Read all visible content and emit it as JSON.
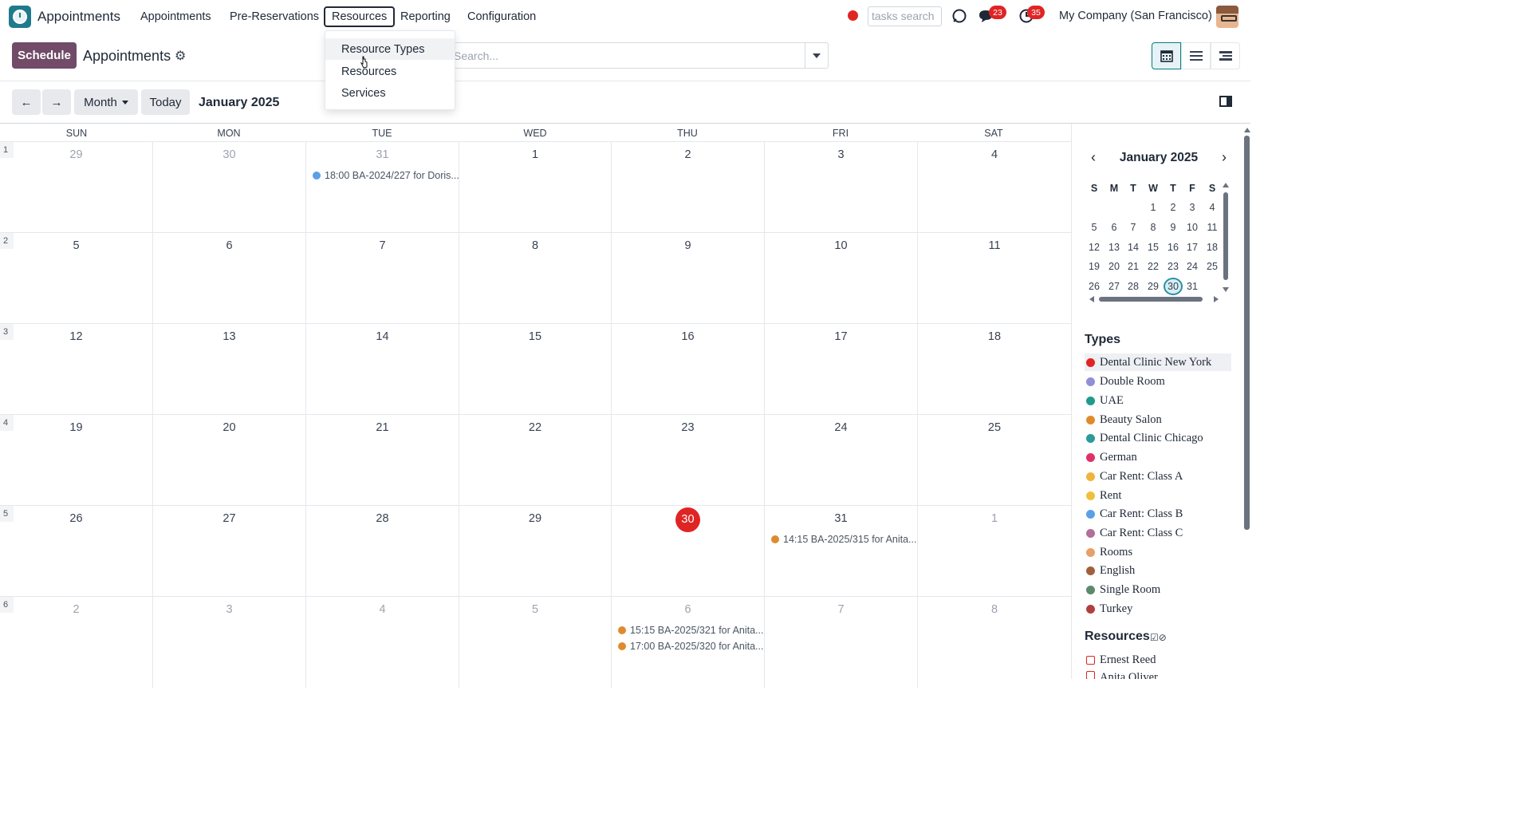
{
  "navbar": {
    "app_name": "Appointments",
    "menus": [
      "Appointments",
      "Pre-Reservations",
      "Resources",
      "Reporting",
      "Configuration"
    ],
    "tasks_search_placeholder": "tasks search",
    "chat_badge": "23",
    "activity_badge": "35",
    "company": "My Company (San Francisco)"
  },
  "control": {
    "schedule_label": "Schedule",
    "title": "Appointments",
    "search_placeholder": "Search..."
  },
  "dropdown": {
    "items": [
      "Resource Types",
      "Resources",
      "Services"
    ]
  },
  "toolbar": {
    "prev": "←",
    "next": "→",
    "scale": "Month",
    "today": "Today",
    "period": "January 2025"
  },
  "calendar": {
    "weekdays": [
      "SUN",
      "MON",
      "TUE",
      "WED",
      "THU",
      "FRI",
      "SAT"
    ],
    "weeks": [
      {
        "num": "1",
        "days": [
          "29",
          "30",
          "31",
          "1",
          "2",
          "3",
          "4"
        ]
      },
      {
        "num": "2",
        "days": [
          "5",
          "6",
          "7",
          "8",
          "9",
          "10",
          "11"
        ]
      },
      {
        "num": "3",
        "days": [
          "12",
          "13",
          "14",
          "15",
          "16",
          "17",
          "18"
        ]
      },
      {
        "num": "4",
        "days": [
          "19",
          "20",
          "21",
          "22",
          "23",
          "24",
          "25"
        ]
      },
      {
        "num": "5",
        "days": [
          "26",
          "27",
          "28",
          "29",
          "30",
          "31",
          "1"
        ]
      },
      {
        "num": "6",
        "days": [
          "2",
          "3",
          "4",
          "5",
          "6",
          "7",
          "8"
        ]
      }
    ],
    "events": [
      {
        "label": "18:00 BA-2024/227 for Doris...",
        "color": "#5aa0e6"
      },
      {
        "label": "14:15 BA-2025/315 for Anita...",
        "color": "#e08a2e"
      },
      {
        "label": "15:15 BA-2025/321 for Anita...",
        "color": "#e08a2e"
      },
      {
        "label": "17:00 BA-2025/320 for Anita...",
        "color": "#e08a2e"
      }
    ]
  },
  "mini_calendar": {
    "title": "January 2025",
    "weekdays": [
      "S",
      "M",
      "T",
      "W",
      "T",
      "F",
      "S"
    ],
    "rows": [
      [
        "",
        "",
        "",
        "1",
        "2",
        "3",
        "4"
      ],
      [
        "5",
        "6",
        "7",
        "8",
        "9",
        "10",
        "11"
      ],
      [
        "12",
        "13",
        "14",
        "15",
        "16",
        "17",
        "18"
      ],
      [
        "19",
        "20",
        "21",
        "22",
        "23",
        "24",
        "25"
      ],
      [
        "26",
        "27",
        "28",
        "29",
        "30",
        "31",
        ""
      ]
    ],
    "selected": "30"
  },
  "types": {
    "title": "Types",
    "items": [
      {
        "label": "Dental Clinic New York",
        "color": "#e02424"
      },
      {
        "label": "Double Room",
        "color": "#8e8fd6"
      },
      {
        "label": "UAE",
        "color": "#1f9b8c"
      },
      {
        "label": "Beauty Salon",
        "color": "#e08a2e"
      },
      {
        "label": "Dental Clinic Chicago",
        "color": "#2b9a9a"
      },
      {
        "label": "German",
        "color": "#e0306a"
      },
      {
        "label": "Car Rent: Class A",
        "color": "#f0b43c"
      },
      {
        "label": "Rent",
        "color": "#f0c03c"
      },
      {
        "label": "Car Rent: Class B",
        "color": "#5aa0e6"
      },
      {
        "label": "Car Rent: Class C",
        "color": "#b0709a"
      },
      {
        "label": "Rooms",
        "color": "#e6a06a"
      },
      {
        "label": "English",
        "color": "#a0603a"
      },
      {
        "label": "Single Room",
        "color": "#5a8a6a"
      },
      {
        "label": "Turkey",
        "color": "#b04040"
      }
    ]
  },
  "resources": {
    "title": "Resources",
    "items": [
      "Ernest Reed",
      "Anita Oliver"
    ]
  }
}
